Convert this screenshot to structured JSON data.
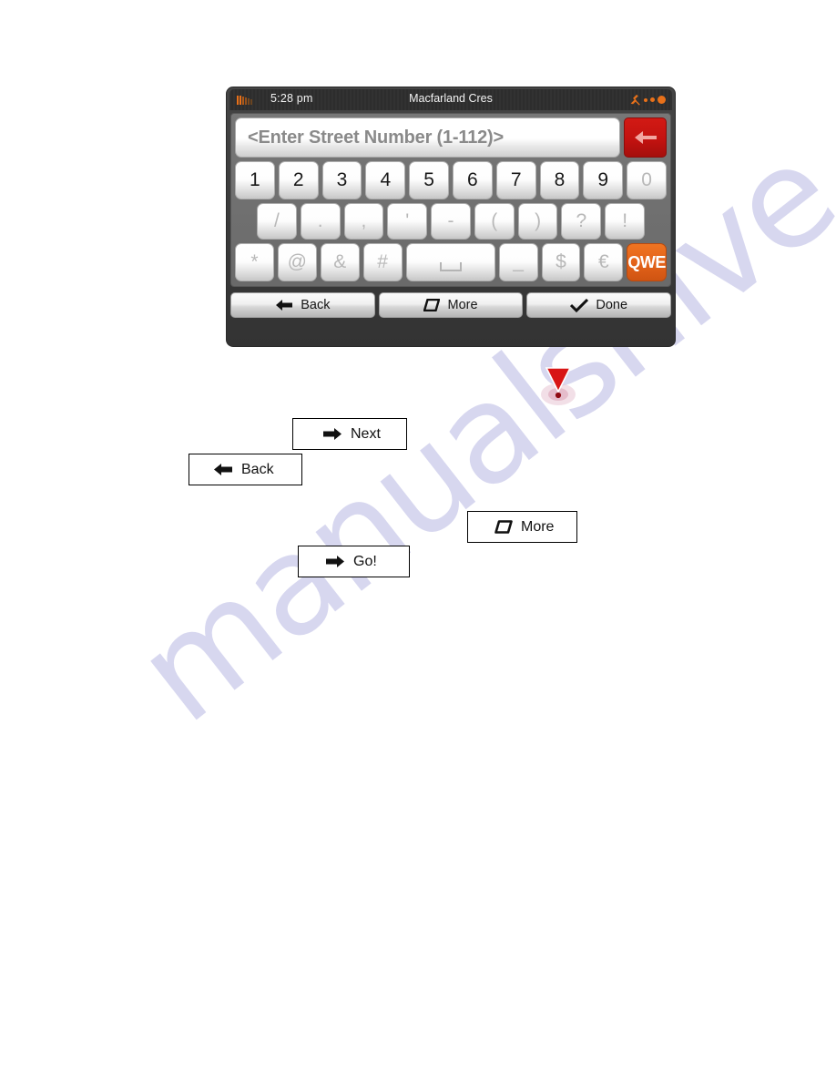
{
  "watermark": {
    "text": "manualshive.com"
  },
  "device": {
    "statusbar": {
      "time": "5:28 pm",
      "title": "Macfarland Cres",
      "battery_icon": "battery-icon",
      "satellite_icon": "satellite-icon",
      "signal_dots": [
        "dot-small",
        "dot-medium",
        "dot-large"
      ]
    },
    "input": {
      "placeholder": "<Enter Street Number (1-112)>",
      "value": "",
      "backspace_icon": "backspace-arrow-icon",
      "backspace_color": "#c31210"
    },
    "keyboard": {
      "accent_color": "#e4631a",
      "row1": [
        {
          "label": "1",
          "disabled": false
        },
        {
          "label": "2",
          "disabled": false
        },
        {
          "label": "3",
          "disabled": false
        },
        {
          "label": "4",
          "disabled": false
        },
        {
          "label": "5",
          "disabled": false
        },
        {
          "label": "6",
          "disabled": false
        },
        {
          "label": "7",
          "disabled": false
        },
        {
          "label": "8",
          "disabled": false
        },
        {
          "label": "9",
          "disabled": false
        },
        {
          "label": "0",
          "disabled": true
        }
      ],
      "row2": [
        {
          "label": "/",
          "disabled": true
        },
        {
          "label": ".",
          "disabled": true
        },
        {
          "label": ",",
          "disabled": true
        },
        {
          "label": "'",
          "disabled": true
        },
        {
          "label": "-",
          "disabled": true
        },
        {
          "label": "(",
          "disabled": true
        },
        {
          "label": ")",
          "disabled": true
        },
        {
          "label": "?",
          "disabled": true
        },
        {
          "label": "!",
          "disabled": true
        }
      ],
      "row3": [
        {
          "label": "*",
          "disabled": true,
          "kind": "char"
        },
        {
          "label": "@",
          "disabled": true,
          "kind": "char"
        },
        {
          "label": "&",
          "disabled": true,
          "kind": "char"
        },
        {
          "label": "#",
          "disabled": true,
          "kind": "char"
        },
        {
          "label": "",
          "disabled": true,
          "kind": "space"
        },
        {
          "label": "_",
          "disabled": true,
          "kind": "char"
        },
        {
          "label": "$",
          "disabled": true,
          "kind": "char"
        },
        {
          "label": "€",
          "disabled": true,
          "kind": "char"
        },
        {
          "label": "QWE",
          "disabled": false,
          "kind": "qwe"
        }
      ]
    },
    "bottom_bar": [
      {
        "label": "Back",
        "icon": "arrow-left-icon"
      },
      {
        "label": "More",
        "icon": "rounded-parallelogram-icon"
      },
      {
        "label": "Done",
        "icon": "checkmark-icon"
      }
    ]
  },
  "callouts": [
    {
      "label": "Next",
      "icon": "arrow-right-icon"
    },
    {
      "label": "Back",
      "icon": "arrow-left-icon"
    },
    {
      "label": "More",
      "icon": "rounded-parallelogram-icon"
    },
    {
      "label": "Go!",
      "icon": "arrow-right-icon"
    }
  ],
  "warning": {
    "icon": "warning-triangle-icon",
    "color": "#d81515"
  }
}
